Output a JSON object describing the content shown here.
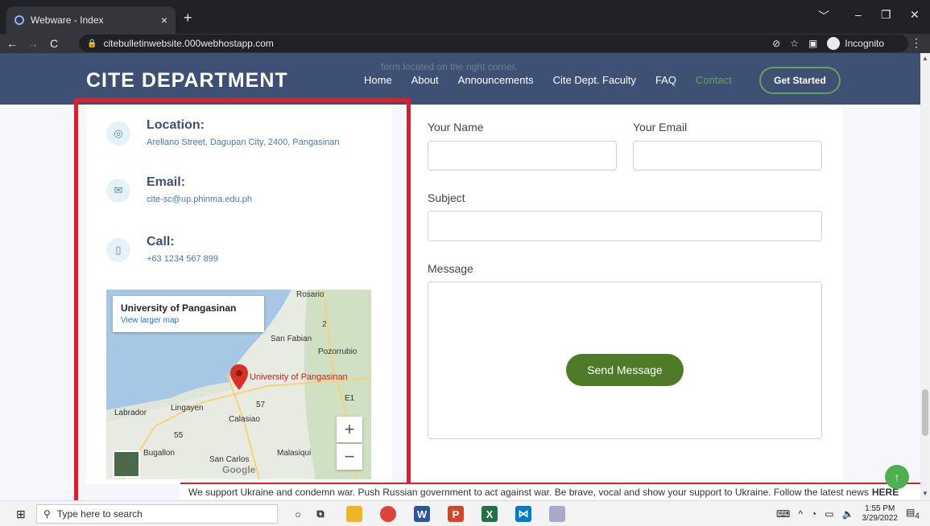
{
  "browser": {
    "tab_title": "Webware - Index",
    "tab_close": "×",
    "new_tab": "+",
    "url": "citebulletinwebsite.000webhostapp.com",
    "incognito_label": "Incognito",
    "window_controls": [
      "﹀",
      "–",
      "❐",
      "✕"
    ]
  },
  "header": {
    "ghost_text": "form located on the right corner.",
    "brand": "CITE DEPARTMENT",
    "nav": [
      "Home",
      "About",
      "Announcements",
      "Cite Dept. Faculty",
      "FAQ",
      "Contact"
    ],
    "active_nav": "Contact",
    "cta": "Get Started"
  },
  "contact_info": {
    "location": {
      "label": "Location:",
      "value": "Arellano Street, Dagupan City, 2400, Pangasinan",
      "icon": "map-pin-icon"
    },
    "email": {
      "label": "Email:",
      "value": "cite-sc@up.phinma.edu.ph",
      "icon": "envelope-icon"
    },
    "call": {
      "label": "Call:",
      "value": "+63 1234 567 899",
      "icon": "phone-icon"
    }
  },
  "map": {
    "place": "University of Pangasinan",
    "larger_link": "View larger map",
    "labels": [
      "Rosario",
      "San Fabian",
      "Pozorrubio",
      "Labrador",
      "Lingayen",
      "Calasiao",
      "Bugallon",
      "San Carlos",
      "Malasiqui"
    ],
    "road_labels": [
      "2",
      "57",
      "55",
      "E1"
    ],
    "zoom_in": "+",
    "zoom_out": "−",
    "logo": "Google"
  },
  "form": {
    "name_label": "Your Name",
    "email_label": "Your Email",
    "subject_label": "Subject",
    "message_label": "Message",
    "send_button": "Send Message"
  },
  "banner": {
    "text": "We support Ukraine and condemn war. Push Russian government to act against war. Be brave, vocal and show your support to Ukraine. Follow the latest news",
    "link": "HERE"
  },
  "taskbar": {
    "search_placeholder": "Type here to search",
    "time": "1:55 PM",
    "date": "3/29/2022",
    "notifications": "4"
  },
  "colors": {
    "header_bg": "#3e5073",
    "accent_green": "#5fa55f",
    "button_green": "#4f7a28",
    "highlight_red": "#e21c2a"
  }
}
